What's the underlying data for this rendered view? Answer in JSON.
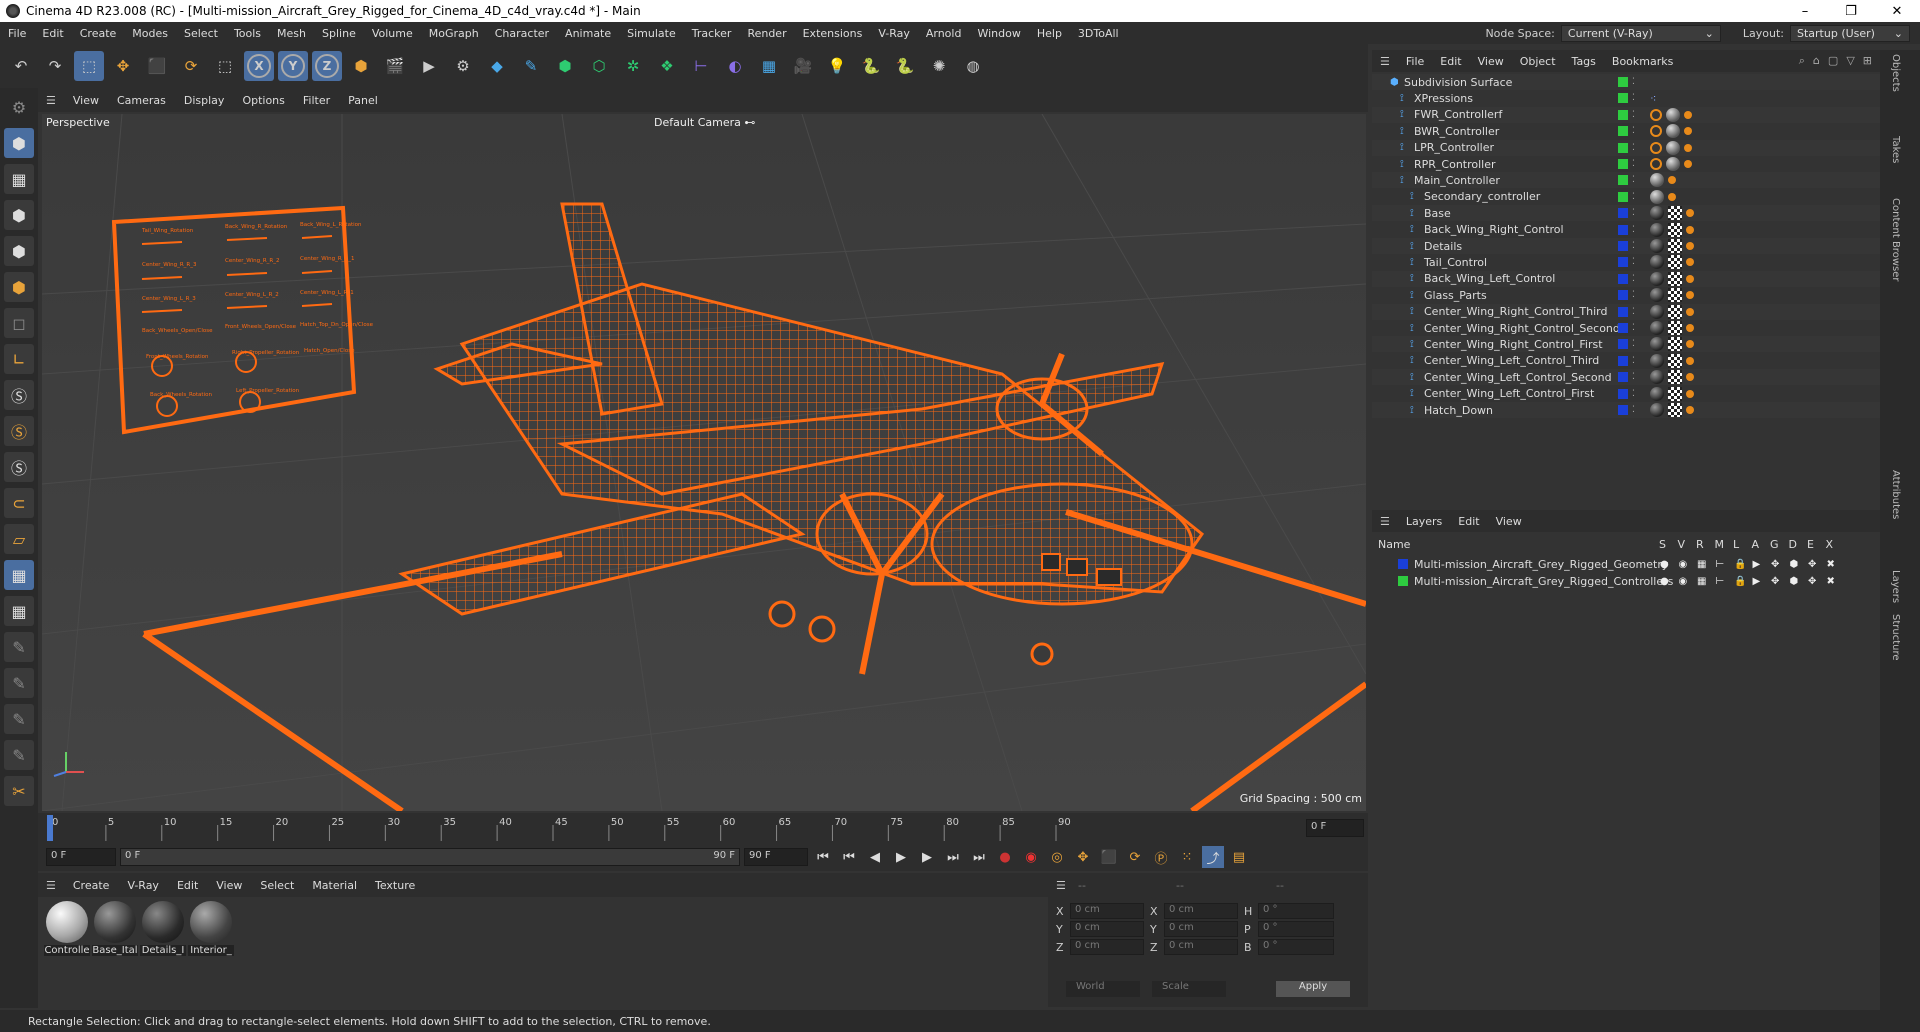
{
  "window": {
    "title": "Cinema 4D R23.008 (RC) - [Multi-mission_Aircraft_Grey_Rigged_for_Cinema_4D_c4d_vray.c4d *] - Main"
  },
  "menubar": {
    "items": [
      "File",
      "Edit",
      "Create",
      "Modes",
      "Select",
      "Tools",
      "Mesh",
      "Spline",
      "Volume",
      "MoGraph",
      "Character",
      "Animate",
      "Simulate",
      "Tracker",
      "Render",
      "Extensions",
      "V-Ray",
      "Arnold",
      "Window",
      "Help",
      "3DToAll"
    ],
    "node_space_label": "Node Space:",
    "node_space_value": "Current (V-Ray)",
    "layout_label": "Layout:",
    "layout_value": "Startup (User)"
  },
  "toolbar": {
    "axis_x": "X",
    "axis_y": "Y",
    "axis_z": "Z"
  },
  "viewport": {
    "menu": [
      "View",
      "Cameras",
      "Display",
      "Options",
      "Filter",
      "Panel"
    ],
    "label": "Perspective",
    "camera": "Default Camera",
    "grid_spacing": "Grid Spacing : 500 cm",
    "hud_controls": [
      "Tail_Wing_Rotation",
      "Back_Wing_R_Rotation",
      "Back_Wing_L_Rotation",
      "Center_Wing_R_R_3",
      "Center_Wing_R_R_2",
      "Center_Wing_R_R_1",
      "Center_Wing_L_R_3",
      "Center_Wing_L_R_2",
      "Center_Wing_L_R_1",
      "Back_Wheels_Open/Close",
      "Front_Wheels_Open/Close",
      "Hatch_Top_Dn_Open/Close",
      "Front_Wheels_Rotation",
      "Right_Propeller_Rotation",
      "Hatch_Open/Close",
      "Back_Wheels_Rotation",
      "Left_Propeller_Rotation"
    ]
  },
  "timeline": {
    "ticks": [
      "0",
      "5",
      "10",
      "15",
      "20",
      "25",
      "30",
      "35",
      "40",
      "45",
      "50",
      "55",
      "60",
      "65",
      "70",
      "75",
      "80",
      "85",
      "90"
    ],
    "current_frame": "0 F",
    "start_frame": "0 F",
    "range_start": "0 F",
    "range_end": "90 F",
    "end_frame": "90 F",
    "progress": 0
  },
  "material_manager": {
    "menu": [
      "Create",
      "V-Ray",
      "Edit",
      "View",
      "Select",
      "Material",
      "Texture"
    ],
    "materials": [
      "Controlle",
      "Base_Ital",
      "Details_I",
      "Interior_"
    ]
  },
  "coordinates": {
    "header": [
      "--",
      "--",
      "--"
    ],
    "rows": [
      {
        "a": "X",
        "av": "0 cm",
        "b": "X",
        "bv": "0 cm",
        "c": "H",
        "cv": "0 °"
      },
      {
        "a": "Y",
        "av": "0 cm",
        "b": "Y",
        "bv": "0 cm",
        "c": "P",
        "cv": "0 °"
      },
      {
        "a": "Z",
        "av": "0 cm",
        "b": "Z",
        "bv": "0 cm",
        "c": "B",
        "cv": "0 °"
      }
    ],
    "mode1": "World",
    "mode2": "Scale",
    "apply": "Apply"
  },
  "object_manager": {
    "menu": [
      "File",
      "Edit",
      "View",
      "Object",
      "Tags",
      "Bookmarks"
    ],
    "objects": [
      {
        "name": "Subdivision Surface",
        "indent": 0,
        "color": "#2ecc40"
      },
      {
        "name": "XPressions",
        "indent": 1,
        "color": "#2ecc40"
      },
      {
        "name": "FWR_Controllerf",
        "indent": 1,
        "color": "#2ecc40"
      },
      {
        "name": "BWR_Controller",
        "indent": 1,
        "color": "#2ecc40"
      },
      {
        "name": "LPR_Controller",
        "indent": 1,
        "color": "#2ecc40"
      },
      {
        "name": "RPR_Controller",
        "indent": 1,
        "color": "#2ecc40"
      },
      {
        "name": "Main_Controller",
        "indent": 1,
        "color": "#2ecc40"
      },
      {
        "name": "Secondary_controller",
        "indent": 2,
        "color": "#2ecc40"
      },
      {
        "name": "Base",
        "indent": 2,
        "color": "#1a3fd9"
      },
      {
        "name": "Back_Wing_Right_Control",
        "indent": 2,
        "color": "#1a3fd9"
      },
      {
        "name": "Details",
        "indent": 2,
        "color": "#1a3fd9"
      },
      {
        "name": "Tail_Control",
        "indent": 2,
        "color": "#1a3fd9"
      },
      {
        "name": "Back_Wing_Left_Control",
        "indent": 2,
        "color": "#1a3fd9"
      },
      {
        "name": "Glass_Parts",
        "indent": 2,
        "color": "#1a3fd9"
      },
      {
        "name": "Center_Wing_Right_Control_Third",
        "indent": 2,
        "color": "#1a3fd9"
      },
      {
        "name": "Center_Wing_Right_Control_Second",
        "indent": 2,
        "color": "#1a3fd9"
      },
      {
        "name": "Center_Wing_Right_Control_First",
        "indent": 2,
        "color": "#1a3fd9"
      },
      {
        "name": "Center_Wing_Left_Control_Third",
        "indent": 2,
        "color": "#1a3fd9"
      },
      {
        "name": "Center_Wing_Left_Control_Second",
        "indent": 2,
        "color": "#1a3fd9"
      },
      {
        "name": "Center_Wing_Left_Control_First",
        "indent": 2,
        "color": "#1a3fd9"
      },
      {
        "name": "Hatch_Down",
        "indent": 2,
        "color": "#1a3fd9"
      }
    ]
  },
  "layer_manager": {
    "menu": [
      "Layers",
      "Edit",
      "View"
    ],
    "name_header": "Name",
    "columns": [
      "S",
      "V",
      "R",
      "M",
      "L",
      "A",
      "G",
      "D",
      "E",
      "X"
    ],
    "layers": [
      {
        "name": "Multi-mission_Aircraft_Grey_Rigged_Geometry",
        "color": "#1a3fd9"
      },
      {
        "name": "Multi-mission_Aircraft_Grey_Rigged_Controllers",
        "color": "#2ecc40"
      }
    ]
  },
  "side_tabs": [
    "Objects",
    "Takes",
    "Content Browser",
    "Attributes",
    "Layers",
    "Structure"
  ],
  "statusbar": {
    "text": "Rectangle Selection: Click and drag to rectangle-select elements. Hold down SHIFT to add to the selection, CTRL to remove."
  }
}
